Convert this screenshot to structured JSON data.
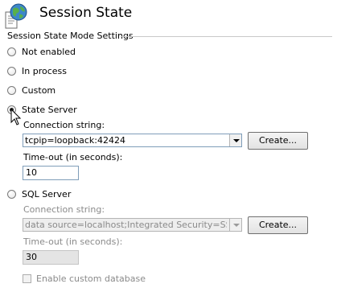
{
  "header": {
    "title": "Session State",
    "icon": "iis-session-page-icon"
  },
  "group": {
    "label": "Session State Mode Settings"
  },
  "modes": {
    "not_enabled": {
      "label": "Not enabled",
      "selected": false
    },
    "in_process": {
      "label": "In process",
      "selected": false
    },
    "custom": {
      "label": "Custom",
      "selected": false
    },
    "state_server": {
      "label": "State Server",
      "selected": true
    },
    "sql_server": {
      "label": "SQL Server",
      "selected": false
    }
  },
  "state_server": {
    "connection_label": "Connection string:",
    "connection_value": "tcpip=loopback:42424",
    "create_label": "Create...",
    "timeout_label": "Time-out (in seconds):",
    "timeout_value": "10"
  },
  "sql_server": {
    "connection_label": "Connection string:",
    "connection_value": "data source=localhost;Integrated Security=SSPI",
    "create_label": "Create...",
    "timeout_label": "Time-out (in seconds):",
    "timeout_value": "30",
    "custom_db_label": "Enable custom database"
  },
  "colors": {
    "input_border": "#7f9db9",
    "disabled_text": "#8a8a8a"
  }
}
